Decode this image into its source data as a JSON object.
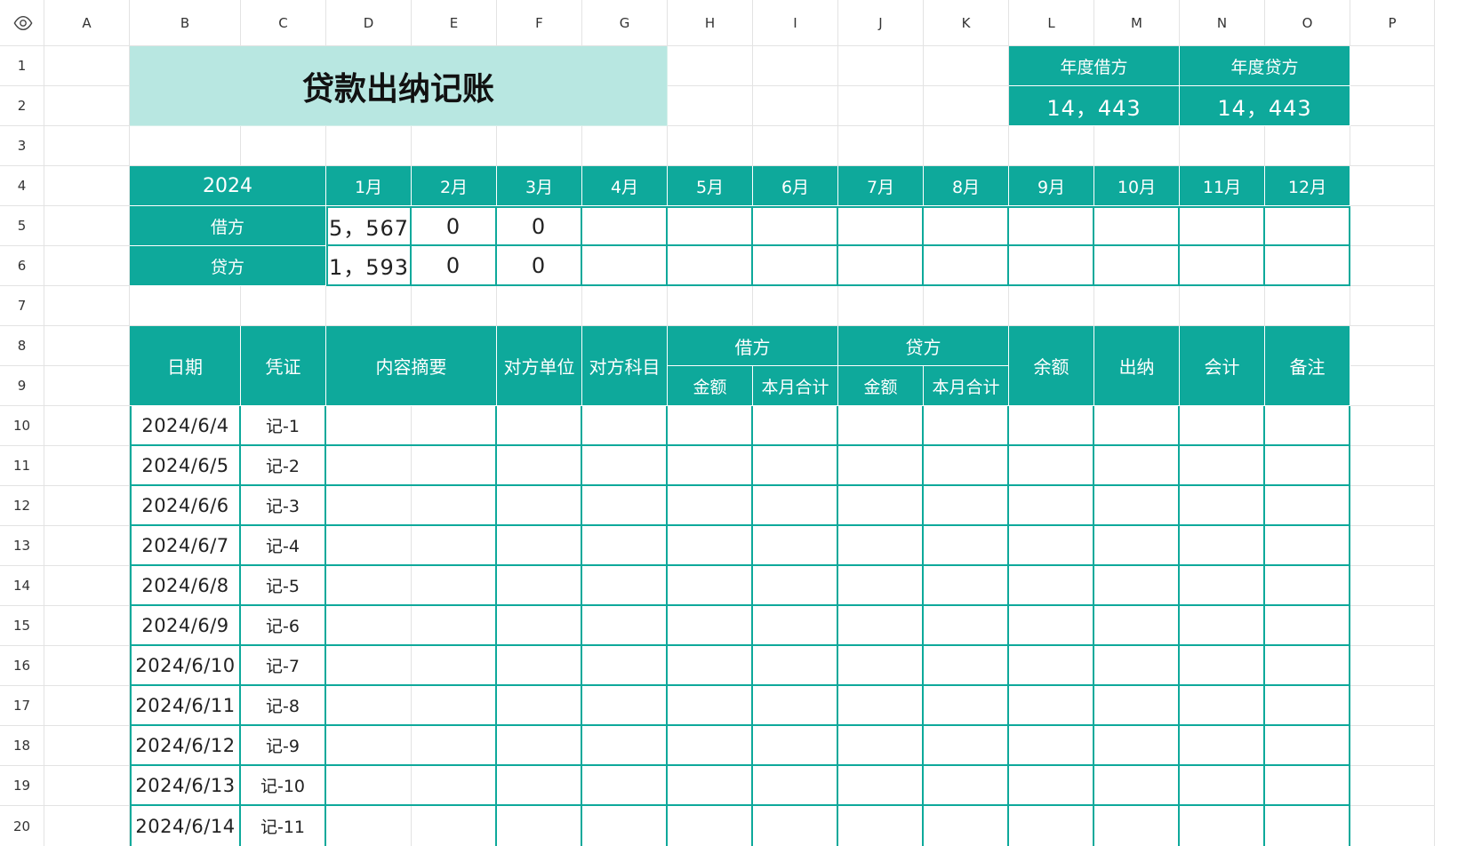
{
  "toolbar": {
    "visibility_icon": "eye-icon"
  },
  "columns": [
    "A",
    "B",
    "C",
    "D",
    "E",
    "F",
    "G",
    "H",
    "I",
    "J",
    "K",
    "L",
    "M",
    "N",
    "O",
    "P"
  ],
  "rows": [
    "1",
    "2",
    "3",
    "4",
    "5",
    "6",
    "7",
    "8",
    "9",
    "10",
    "11",
    "12",
    "13",
    "14",
    "15",
    "16",
    "17",
    "18",
    "19",
    "20"
  ],
  "sheet": {
    "title": "贷款出纳记账",
    "summary": {
      "annual_debit_label": "年度借方",
      "annual_debit_value": "14，443",
      "annual_credit_label": "年度贷方",
      "annual_credit_value": "14，443"
    },
    "monthly": {
      "year": "2024",
      "months": [
        "1月",
        "2月",
        "3月",
        "4月",
        "5月",
        "6月",
        "7月",
        "8月",
        "9月",
        "10月",
        "11月",
        "12月"
      ],
      "rows": [
        {
          "label": "借方",
          "values": [
            "5，567",
            "0",
            "0",
            "",
            "",
            "",
            "",
            "",
            "",
            "",
            "",
            ""
          ]
        },
        {
          "label": "贷方",
          "values": [
            "1，593",
            "0",
            "0",
            "",
            "",
            "",
            "",
            "",
            "",
            "",
            "",
            ""
          ]
        }
      ]
    },
    "ledger": {
      "headers": {
        "date": "日期",
        "voucher": "凭证",
        "summary": "内容摘要",
        "counterparty_unit": "对方单位",
        "counterparty_subject": "对方科目",
        "debit": "借方",
        "credit": "贷方",
        "amount": "金额",
        "month_total": "本月合计",
        "balance": "余额",
        "cashier": "出纳",
        "accountant": "会计",
        "notes": "备注"
      },
      "rows": [
        {
          "date": "2024/6/4",
          "voucher": "记-1"
        },
        {
          "date": "2024/6/5",
          "voucher": "记-2"
        },
        {
          "date": "2024/6/6",
          "voucher": "记-3"
        },
        {
          "date": "2024/6/7",
          "voucher": "记-4"
        },
        {
          "date": "2024/6/8",
          "voucher": "记-5"
        },
        {
          "date": "2024/6/9",
          "voucher": "记-6"
        },
        {
          "date": "2024/6/10",
          "voucher": "记-7"
        },
        {
          "date": "2024/6/11",
          "voucher": "记-8"
        },
        {
          "date": "2024/6/12",
          "voucher": "记-9"
        },
        {
          "date": "2024/6/13",
          "voucher": "记-10"
        },
        {
          "date": "2024/6/14",
          "voucher": "记-11"
        }
      ]
    }
  },
  "colors": {
    "teal": "#0ea99b",
    "title_background": "#b8e7e1",
    "grid_line": "#e3e3e3"
  }
}
